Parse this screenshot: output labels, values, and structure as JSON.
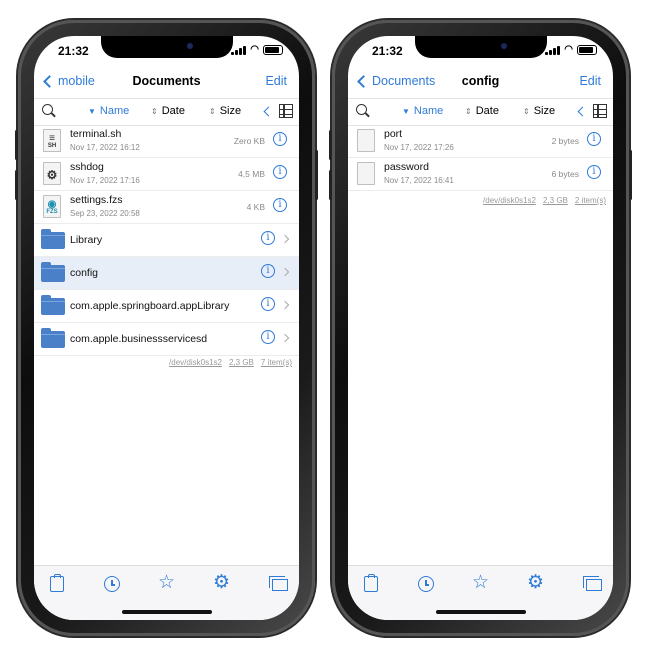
{
  "status_bar": {
    "time": "21:32"
  },
  "left": {
    "nav": {
      "back_label": "mobile",
      "title": "Documents",
      "edit_label": "Edit"
    },
    "sort": {
      "name_label": "Name",
      "date_label": "Date",
      "size_label": "Size",
      "active": "name"
    },
    "files": [
      {
        "name": "terminal.sh",
        "date": "Nov 17, 2022 16:12",
        "size": "Zero KB",
        "icon": "sh-file-icon",
        "ext": "SH"
      },
      {
        "name": "sshdog",
        "date": "Nov 17, 2022 17:16",
        "size": "4,5 MB",
        "icon": "executable-gear-icon",
        "ext": ""
      },
      {
        "name": "settings.fzs",
        "date": "Sep 23, 2022 20:58",
        "size": "4 KB",
        "icon": "fzs-file-icon",
        "ext": "FZS"
      }
    ],
    "folders": [
      {
        "name": "Library",
        "selected": false
      },
      {
        "name": "config",
        "selected": true
      },
      {
        "name": "com.apple.springboard.appLibrary",
        "selected": false
      },
      {
        "name": "com.apple.businessservicesd",
        "selected": false
      }
    ],
    "footer": {
      "disk": "/dev/disk0s1s2",
      "free": "2,3 GB",
      "items": "7 item(s)"
    }
  },
  "right": {
    "nav": {
      "back_label": "Documents",
      "title": "config",
      "edit_label": "Edit"
    },
    "sort": {
      "name_label": "Name",
      "date_label": "Date",
      "size_label": "Size",
      "active": "name"
    },
    "files": [
      {
        "name": "port",
        "date": "Nov 17, 2022 17:26",
        "size": "2 bytes",
        "icon": "blank-file-icon"
      },
      {
        "name": "password",
        "date": "Nov 17, 2022 16:41",
        "size": "6 bytes",
        "icon": "blank-file-icon"
      }
    ],
    "footer": {
      "disk": "/dev/disk0s1s2",
      "free": "2,3 GB",
      "items": "2 item(s)"
    }
  },
  "toolbar": [
    "clipboard-icon",
    "history-clock-icon",
    "favorites-star-icon",
    "settings-gear-icon",
    "tabs-icon"
  ],
  "colors": {
    "accent": "#2f7bd8",
    "folder": "#4a80c8",
    "selected_row": "#e8eef8"
  }
}
